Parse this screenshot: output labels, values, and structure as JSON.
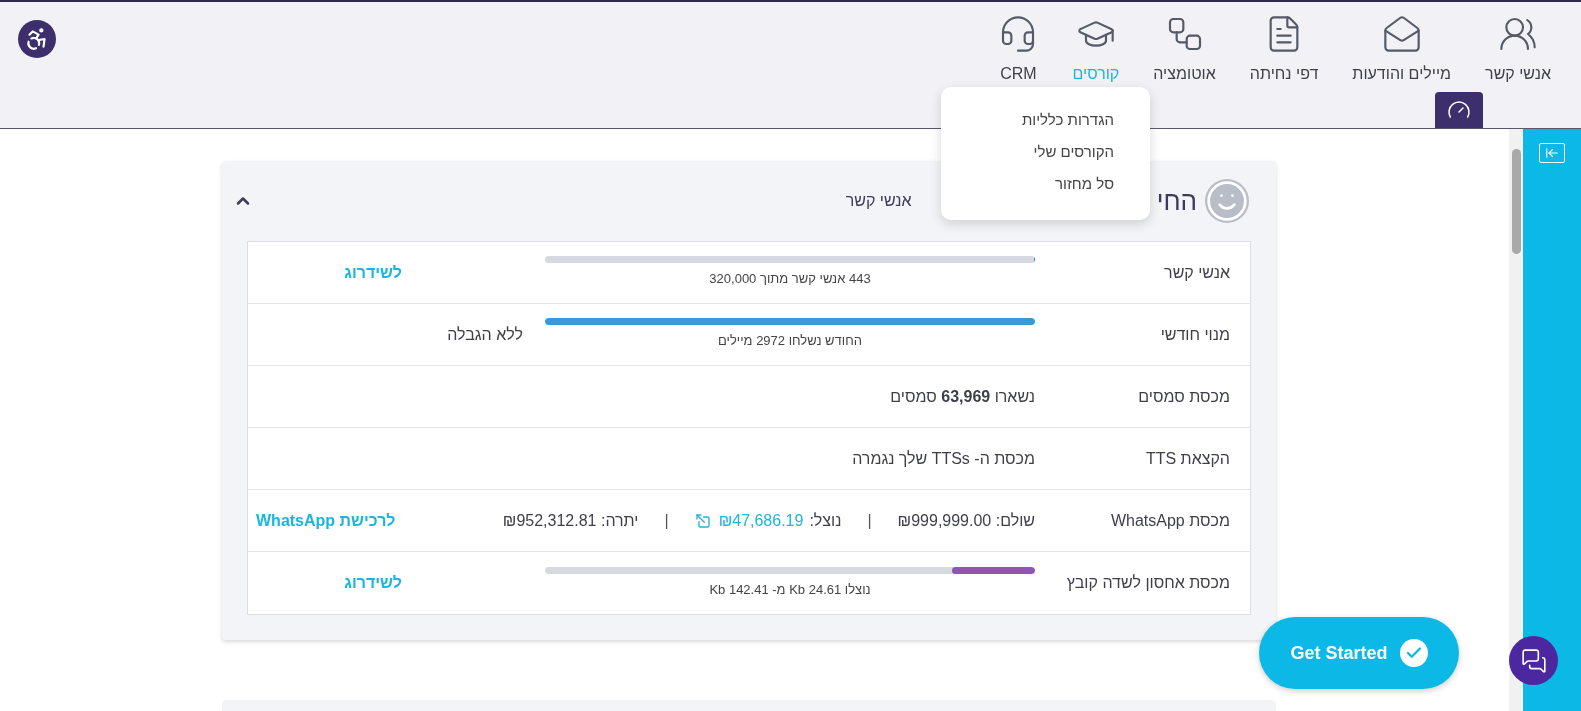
{
  "nav": {
    "items": [
      {
        "label": "אנשי קשר",
        "selected": false
      },
      {
        "label": "מיילים והודעות",
        "selected": false
      },
      {
        "label": "דפי נחיתה",
        "selected": false
      },
      {
        "label": "אוטומציה",
        "selected": false
      },
      {
        "label": "קורסים",
        "selected": true
      },
      {
        "label": "CRM",
        "selected": false
      }
    ]
  },
  "dropdown": {
    "items": [
      "הגדרות כלליות",
      "הקורסים שלי",
      "סל מחזור"
    ]
  },
  "card": {
    "title": "החי",
    "subtitle": "אנשי קשר",
    "expanded": true,
    "rows": [
      {
        "kind": "bar",
        "label": "אנשי קשר",
        "level": 0.0014,
        "caption": "443 אנשי קשר מתוך 320,000",
        "link": "לשידרוג"
      },
      {
        "kind": "bar",
        "label": "מנוי חודשי",
        "level": 1,
        "color": "#3b98d9",
        "caption": "החודש נשלחו 2972 מיילים",
        "note": "ללא הגבלה"
      },
      {
        "kind": "text",
        "label": "מכסת סמסים",
        "value": "נשארו **63,969** סמסים"
      },
      {
        "kind": "text",
        "label": "הקצאת TTS",
        "value": "מכסת ה- TTSs שלך נגמרה"
      },
      {
        "kind": "whatsapp",
        "label": "מכסת WhatsApp",
        "paid": "שולם: ₪999,999.00",
        "separators": [
          "|",
          "|"
        ],
        "used_label": "נוצל:",
        "used": "₪47,686.19",
        "balance": "יתרה: ₪952,312.81",
        "link": "לרכישת WhatsApp"
      },
      {
        "kind": "bar",
        "label": "מכסת אחסון לשדה קובץ",
        "level": 0.17,
        "color": "#8e55b5",
        "caption": "נוצלו 24.61 Kb מ- 142.41 Kb",
        "link": "לשידרוג"
      }
    ]
  },
  "get_started": {
    "label": "Get Started"
  }
}
